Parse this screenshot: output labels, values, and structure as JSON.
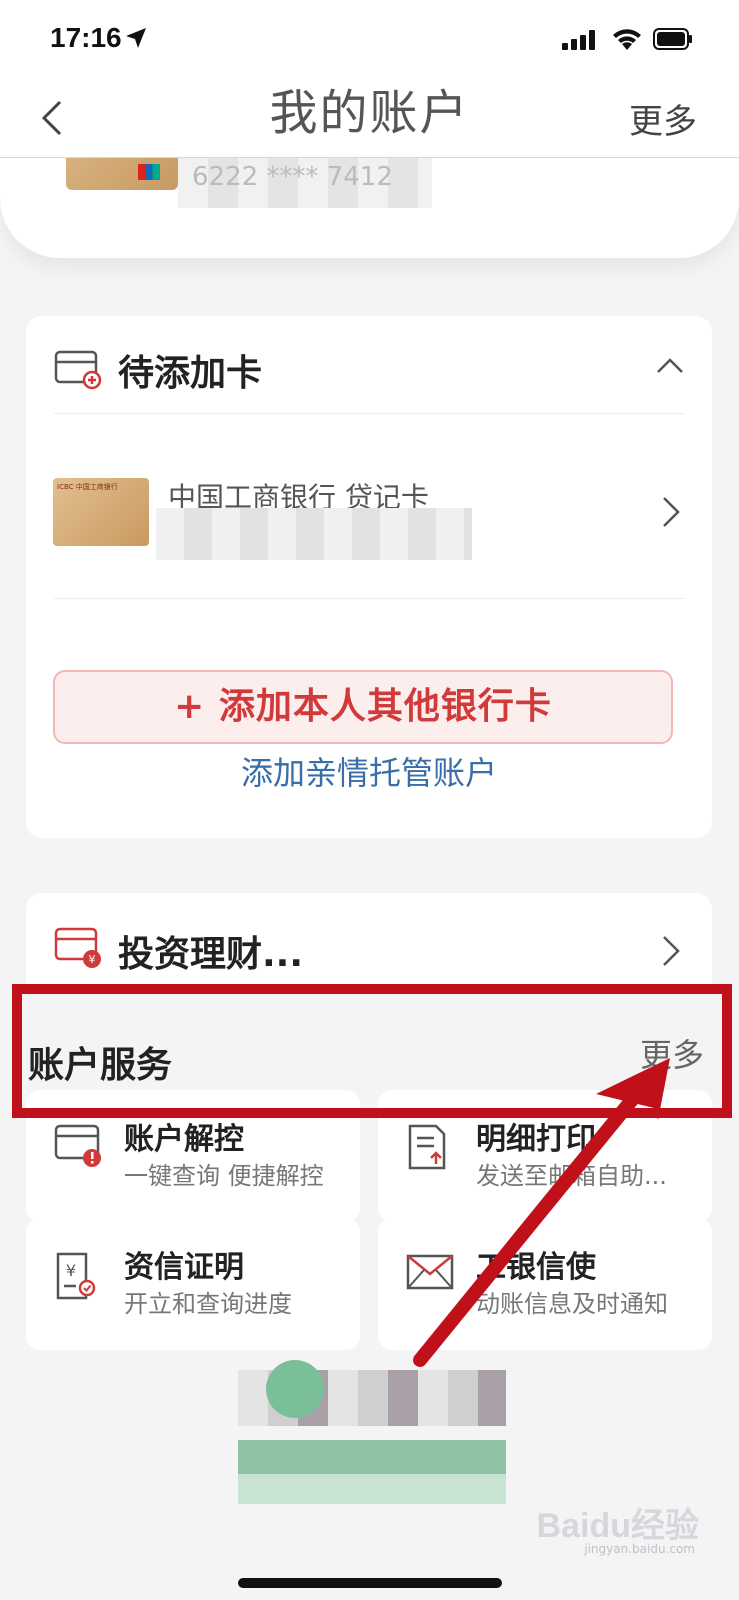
{
  "status_bar": {
    "time": "17:16"
  },
  "nav": {
    "title": "我的账户",
    "more": "更多"
  },
  "top_card": {
    "number_masked": "6222 **** 7412"
  },
  "pending_cards": {
    "title": "待添加卡",
    "bank_name": "中国工商银行 贷记卡",
    "card_logo": "ICBC 中国工商银行",
    "add_button": "+ 添加本人其他银行卡",
    "family_link": "添加亲情托管账户"
  },
  "invest": {
    "title": "投资理财..."
  },
  "account_services": {
    "title": "账户服务",
    "more": "更多",
    "items": [
      {
        "title": "账户解控",
        "subtitle": "一键查询 便捷解控",
        "icon": "card-alert-icon"
      },
      {
        "title": "明细打印",
        "subtitle": "发送至邮箱自助...",
        "icon": "document-upload-icon"
      },
      {
        "title": "资信证明",
        "subtitle": "开立和查询进度",
        "icon": "certificate-icon"
      },
      {
        "title": "工银信使",
        "subtitle": "动账信息及时通知",
        "icon": "envelope-icon"
      }
    ]
  },
  "watermark": {
    "brand": "Baidu经验",
    "url": "jingyan.baidu.com"
  },
  "colors": {
    "accent_red": "#d13a3a",
    "link_blue": "#3a6ea8",
    "annotation_red": "#c0111a"
  }
}
